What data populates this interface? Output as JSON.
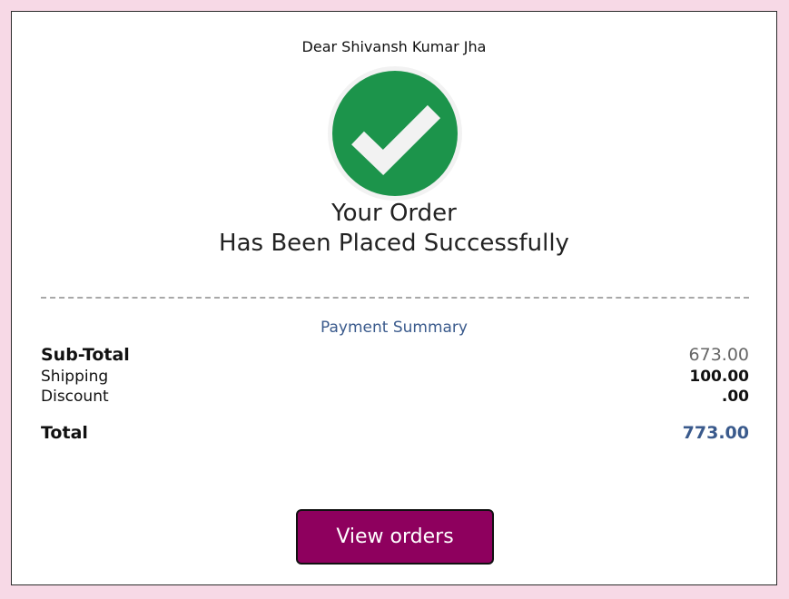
{
  "greeting": "Dear Shivansh Kumar Jha",
  "success_icon": "check-circle-icon",
  "headline": {
    "line1": "Your Order",
    "line2": "Has Been Placed Successfully"
  },
  "summary": {
    "title": "Payment Summary",
    "subtotal": {
      "label": "Sub-Total",
      "value": "673.00"
    },
    "shipping": {
      "label": "Shipping",
      "value": "100.00"
    },
    "discount": {
      "label": "Discount",
      "value": ".00"
    },
    "total": {
      "label": "Total",
      "value": "773.00"
    }
  },
  "actions": {
    "view_orders_label": "View orders"
  },
  "colors": {
    "background": "#f7d9e6",
    "success_green": "#1c944b",
    "accent_blue": "#3a5a8c",
    "button": "#8e005e"
  }
}
